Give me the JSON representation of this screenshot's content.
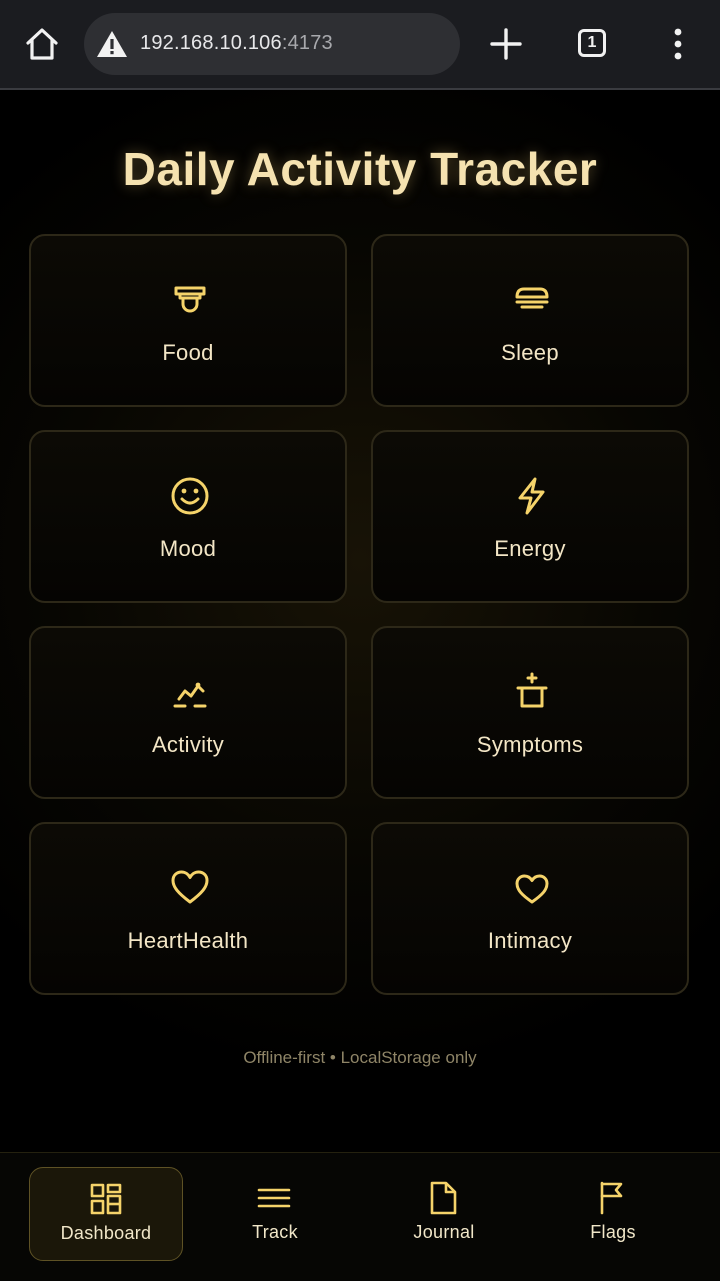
{
  "browser": {
    "url_host": "192.168.10.106",
    "url_port": ":4173",
    "tab_count": "1",
    "icons": [
      "home-icon",
      "warning-icon",
      "plus-icon",
      "tabs-icon",
      "more-vert-icon"
    ]
  },
  "page": {
    "title": "Daily Activity Tracker",
    "footer": "Offline-first • LocalStorage only",
    "accent_color": "#f5d36a",
    "cards": [
      {
        "label": "Food",
        "icon": "bowl-icon"
      },
      {
        "label": "Sleep",
        "icon": "bed-icon"
      },
      {
        "label": "Mood",
        "icon": "smile-icon"
      },
      {
        "label": "Energy",
        "icon": "lightning-icon"
      },
      {
        "label": "Activity",
        "icon": "activity-icon"
      },
      {
        "label": "Symptoms",
        "icon": "medical-icon"
      },
      {
        "label": "HeartHealth",
        "icon": "heart-icon"
      },
      {
        "label": "Intimacy",
        "icon": "heart-icon"
      }
    ]
  },
  "nav": {
    "items": [
      {
        "label": "Dashboard",
        "icon": "dashboard-icon",
        "active": true
      },
      {
        "label": "Track",
        "icon": "menu-icon",
        "active": false
      },
      {
        "label": "Journal",
        "icon": "document-icon",
        "active": false
      },
      {
        "label": "Flags",
        "icon": "flag-icon",
        "active": false
      }
    ]
  }
}
